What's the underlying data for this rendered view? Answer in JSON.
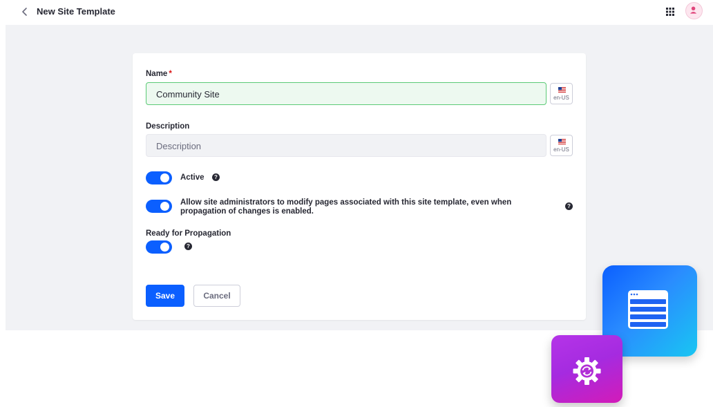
{
  "header": {
    "title": "New Site Template"
  },
  "form": {
    "name": {
      "label": "Name",
      "required_mark": "*",
      "value": "Community Site",
      "locale": "en-US"
    },
    "description": {
      "label": "Description",
      "placeholder": "Description",
      "locale": "en-US"
    },
    "toggles": [
      {
        "label": "Active",
        "on": true
      },
      {
        "label_line1": "Allow site administrators to modify pages associated with this site template, even when",
        "label_line2": "propagation of changes is enabled.",
        "on": true
      }
    ],
    "propagation": {
      "label": "Ready for Propagation",
      "on": true
    },
    "save_label": "Save",
    "cancel_label": "Cancel"
  },
  "icons": {
    "back": "chevron-left-icon",
    "apps": "apps-grid-icon",
    "user": "user-avatar-icon",
    "help": "question-circle-icon",
    "site_template": "site-template-icon",
    "settings": "gear-sync-icon"
  },
  "colors": {
    "primary": "#0b5fff",
    "success_border": "#5aca75",
    "success_bg": "#edf9f0",
    "tile_blue": "#0b5fff",
    "tile_purple": "#b534e8"
  }
}
